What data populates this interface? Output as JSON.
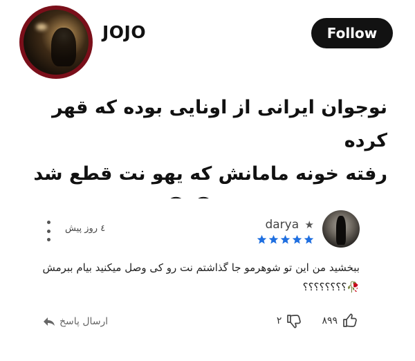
{
  "profile": {
    "username": "JOJO",
    "follow_label": "Follow"
  },
  "caption": {
    "line1": "نوجوان ایرانی از اونایی بوده که قهر کرده",
    "line2": "رفته خونه مامانش  که یهو نت قطع شد",
    "emojis": "😂😂"
  },
  "review": {
    "reviewer_name": "darya",
    "star_symbol": "★",
    "rating_stars": 5,
    "time_ago": "٤ روز پیش",
    "text": "ببخشید من این تو شوهرمو جا گذاشتم نت رو کی وصل میکنید بیام ببرمش 🥀؟؟؟؟؟؟؟؟",
    "likes": "۸۹۹",
    "dislikes": "۲",
    "reply_label": "ارسال پاسخ",
    "accent_color": "#1f6fe0"
  },
  "icons": {
    "menu": "more-vertical-icon",
    "thumbs_up": "thumbs-up-icon",
    "thumbs_down": "thumbs-down-icon",
    "reply": "reply-arrow-icon"
  }
}
